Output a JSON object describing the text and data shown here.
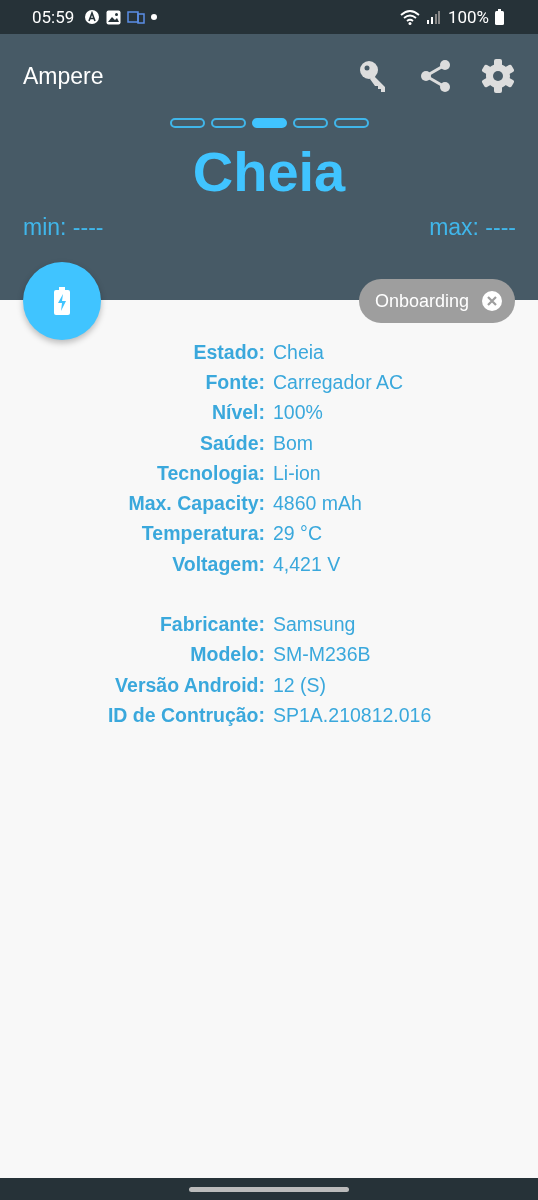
{
  "status_bar": {
    "time": "05:59",
    "battery": "100%"
  },
  "app_bar": {
    "title": "Ampere"
  },
  "pages": [
    {
      "selected": false
    },
    {
      "selected": false
    },
    {
      "selected": true
    },
    {
      "selected": false
    },
    {
      "selected": false
    }
  ],
  "status": "Cheia",
  "min": "min: ----",
  "max": "max: ----",
  "chip": {
    "label": "Onboarding"
  },
  "info_groups": [
    [
      {
        "label": "Estado:",
        "value": "Cheia"
      },
      {
        "label": "Fonte:",
        "value": "Carregador AC"
      },
      {
        "label": "Nível:",
        "value": "100%"
      },
      {
        "label": "Saúde:",
        "value": "Bom"
      },
      {
        "label": "Tecnologia:",
        "value": "Li-ion"
      },
      {
        "label": "Max. Capacity:",
        "value": "4860 mAh"
      },
      {
        "label": "Temperatura:",
        "value": "29 °C"
      },
      {
        "label": "Voltagem:",
        "value": "4,421 V"
      }
    ],
    [
      {
        "label": "Fabricante:",
        "value": "Samsung"
      },
      {
        "label": "Modelo:",
        "value": "SM-M236B"
      },
      {
        "label": "Versão Android:",
        "value": "12 (S)"
      },
      {
        "label": "ID de Contrução:",
        "value": "SP1A.210812.016"
      }
    ]
  ]
}
